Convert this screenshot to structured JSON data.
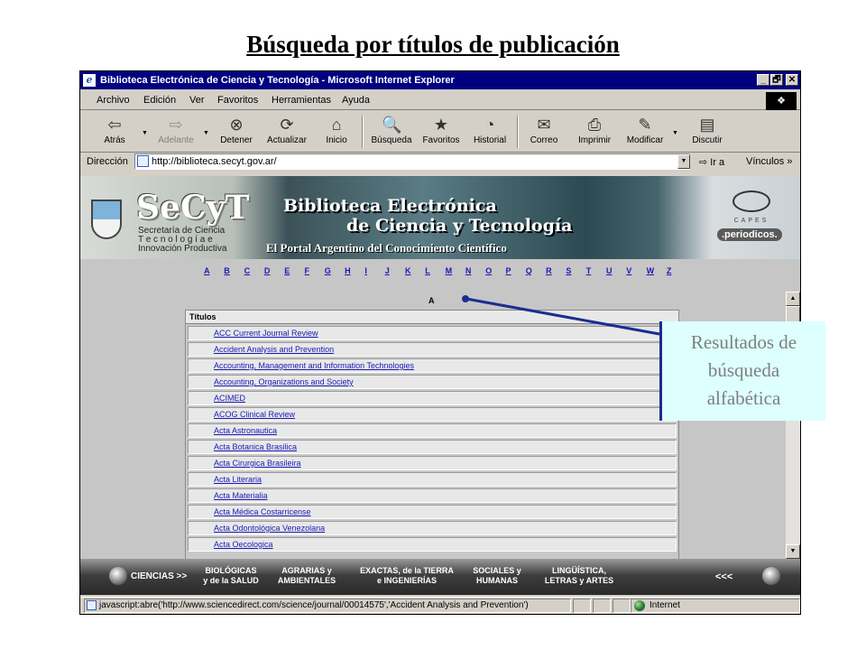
{
  "slide": {
    "title": "Búsqueda por títulos de publicación"
  },
  "window": {
    "title": "Biblioteca Electrónica de Ciencia y Tecnología - Microsoft Internet Explorer",
    "icon_glyph": "e",
    "minimize_glyph": "_",
    "maximize_glyph": "🗗",
    "close_glyph": "✕"
  },
  "menu": [
    "Archivo",
    "Edición",
    "Ver",
    "Favoritos",
    "Herramientas",
    "Ayuda"
  ],
  "toolbar": {
    "back": "Atrás",
    "forward": "Adelante",
    "stop": "Detener",
    "refresh": "Actualizar",
    "home": "Inicio",
    "search": "Búsqueda",
    "favorites": "Favoritos",
    "history": "Historial",
    "mail": "Correo",
    "print": "Imprimir",
    "edit": "Modificar",
    "discuss": "Discutir"
  },
  "icons": {
    "back": "⇦",
    "forward": "⇨",
    "stop": "⊗",
    "refresh": "⟳",
    "home": "⌂",
    "search": "🔍",
    "favorites": "★",
    "history": "◔",
    "mail": "✉",
    "print": "⎙",
    "edit": "✎",
    "discuss": "▤",
    "dropdown": "▼",
    "go": "⇨",
    "chevron": "»",
    "scroll_up": "▲",
    "scroll_down": "▼"
  },
  "address": {
    "label": "Dirección",
    "url": "http://biblioteca.secyt.gov.ar/",
    "go_label": "Ir a",
    "links_label": "Vínculos"
  },
  "banner": {
    "logo": "SeCyT",
    "subtitle_1": "Secretaría de Ciencia",
    "subtitle_2": "T e c n o l o g í a   e",
    "subtitle_3": "Innovación Productiva",
    "title_1": "Biblioteca Electrónica",
    "title_2": "de Ciencia y Tecnología",
    "portal": "El Portal Argentino del Conocimiento Científico",
    "capes": "CAPES",
    "periodicos": ".periodicos."
  },
  "alphabet": [
    "A",
    "B",
    "C",
    "D",
    "E",
    "F",
    "G",
    "H",
    "I",
    "J",
    "K",
    "L",
    "M",
    "N",
    "O",
    "P",
    "Q",
    "R",
    "S",
    "T",
    "U",
    "V",
    "W",
    "Z"
  ],
  "results": {
    "selected_letter": "A",
    "header": "Títulos",
    "items": [
      "ACC Current Journal Review",
      "Accident Analysis and Prevention",
      "Accounting, Management and Information Technologies",
      "Accounting, Organizations and Society",
      "ACIMED",
      "ACOG Clinical Review",
      "Acta Astronautica",
      "Acta Botanica Brasilica",
      "Acta Cirurgica Brasileira",
      "Acta Literaria",
      "Acta Materialia",
      "Acta Médica Costarricense",
      "Acta Odontológica Venezolana",
      "Acta Oecologica"
    ]
  },
  "bottom_nav": {
    "main": "CIENCIAS >>",
    "categories": [
      "BIOLÓGICAS\ny de la SALUD",
      "AGRARIAS y\nAMBIENTALES",
      "EXACTAS, de la TIERRA\ne INGENIERÍAS",
      "SOCIALES y\nHUMANAS",
      "LINGÜÍSTICA,\nLETRAS y ARTES"
    ],
    "back": "<<<"
  },
  "status": {
    "text": "javascript:abre('http://www.sciencedirect.com/science/journal/00014575','Accident Analysis and Prevention')",
    "zone": "Internet"
  },
  "callout": {
    "line_1": "Resultados de",
    "line_2": "búsqueda",
    "line_3": "alfabética"
  }
}
